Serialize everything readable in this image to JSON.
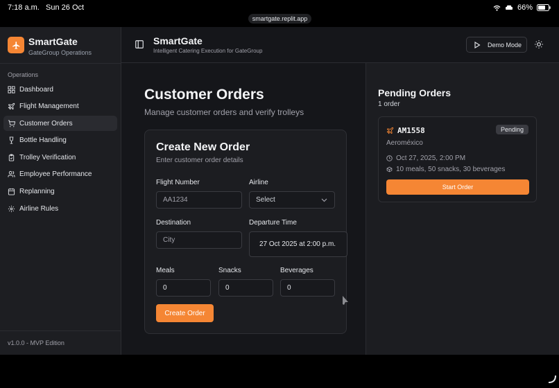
{
  "status_bar": {
    "time": "7:18 a.m.",
    "date": "Sun 26 Oct",
    "battery": "66%"
  },
  "browser": {
    "url": "smartgate.replit.app"
  },
  "sidebar": {
    "brand_name": "SmartGate",
    "brand_sub": "GateGroup Operations",
    "section_label": "Operations",
    "items": [
      {
        "label": "Dashboard",
        "icon": "grid-icon"
      },
      {
        "label": "Flight Management",
        "icon": "plane-icon"
      },
      {
        "label": "Customer Orders",
        "icon": "cart-icon"
      },
      {
        "label": "Bottle Handling",
        "icon": "wine-icon"
      },
      {
        "label": "Trolley Verification",
        "icon": "clipboard-check-icon"
      },
      {
        "label": "Employee Performance",
        "icon": "users-icon"
      },
      {
        "label": "Replanning",
        "icon": "calendar-icon"
      },
      {
        "label": "Airline Rules",
        "icon": "gear-icon"
      }
    ],
    "active_item": "Customer Orders",
    "footer": "v1.0.0 - MVP Edition"
  },
  "header": {
    "title": "SmartGate",
    "subtitle": "Intelligent Catering Execution for GateGroup",
    "demo_button": "Demo Mode"
  },
  "page": {
    "title": "Customer Orders",
    "subtitle": "Manage customer orders and verify trolleys"
  },
  "form": {
    "title": "Create New Order",
    "subtitle": "Enter customer order details",
    "flight_number_label": "Flight Number",
    "flight_number_placeholder": "AA1234",
    "airline_label": "Airline",
    "airline_value": "Select",
    "destination_label": "Destination",
    "destination_placeholder": "City",
    "departure_label": "Departure Time",
    "departure_value": "27 Oct 2025 at 2:00 p.m.",
    "meals_label": "Meals",
    "meals_value": "0",
    "snacks_label": "Snacks",
    "snacks_value": "0",
    "beverages_label": "Beverages",
    "beverages_value": "0",
    "submit_label": "Create Order"
  },
  "pending": {
    "title": "Pending Orders",
    "count": "1 order",
    "orders": [
      {
        "flight": "AM1558",
        "status": "Pending",
        "airline": "Aeroméxico",
        "departure": "Oct 27, 2025, 2:00 PM",
        "items": "10 meals, 50 snacks, 30 beverages",
        "action": "Start Order"
      }
    ]
  },
  "colors": {
    "accent": "#f58634",
    "background": "#15161a",
    "panel": "#1c1d21"
  }
}
